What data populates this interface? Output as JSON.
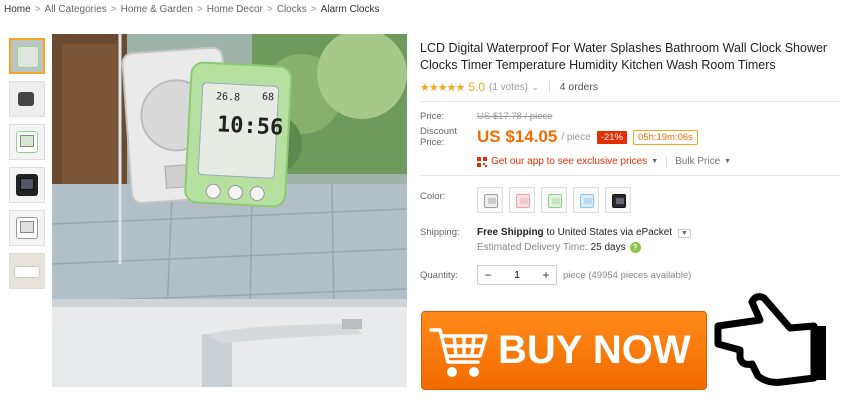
{
  "breadcrumb": {
    "items": [
      "Home",
      "All Categories",
      "Home & Garden",
      "Home Decor",
      "Clocks",
      "Alarm Clocks"
    ],
    "separator": ">"
  },
  "product": {
    "title": "LCD Digital Waterproof For Water Splashes Bathroom Wall Clock Shower Clocks Timer Temperature Humidity Kitchen Wash Room Timers",
    "stars": "★★★★★",
    "rating": "5.0",
    "votes": "(1 votes)",
    "orders": "4 orders",
    "clock_display": {
      "temp": "26.8",
      "humidity": "68",
      "time": "10:56"
    }
  },
  "price": {
    "price_label": "Price:",
    "old_price": "US $17.78 / piece",
    "discount_label": "Discount Price:",
    "new_price": "US $14.05",
    "per_piece": "/ piece",
    "discount_pct": "-21%",
    "timer": "05h:19m:06s",
    "app_text": "Get our app to see exclusive prices",
    "bulk_price": "Bulk Price"
  },
  "color": {
    "label": "Color:",
    "swatches": [
      "#a0a0a0",
      "#f0a0a8",
      "#8fd08a",
      "#8ec4f0",
      "#2a2a2a"
    ]
  },
  "shipping": {
    "label": "Shipping:",
    "free": "Free Shipping",
    "to_text": "to United States via ePacket",
    "est_label": "Estimated Delivery Time:",
    "est_days": "25 days",
    "help": "?"
  },
  "quantity": {
    "label": "Quantity:",
    "minus": "−",
    "value": "1",
    "plus": "+",
    "available": "piece (49954 pieces available)"
  },
  "buy": {
    "label": "BUY NOW"
  },
  "colors": {
    "accent": "#f56b00",
    "discount_bg": "#e62e04",
    "star": "#f5a623"
  }
}
